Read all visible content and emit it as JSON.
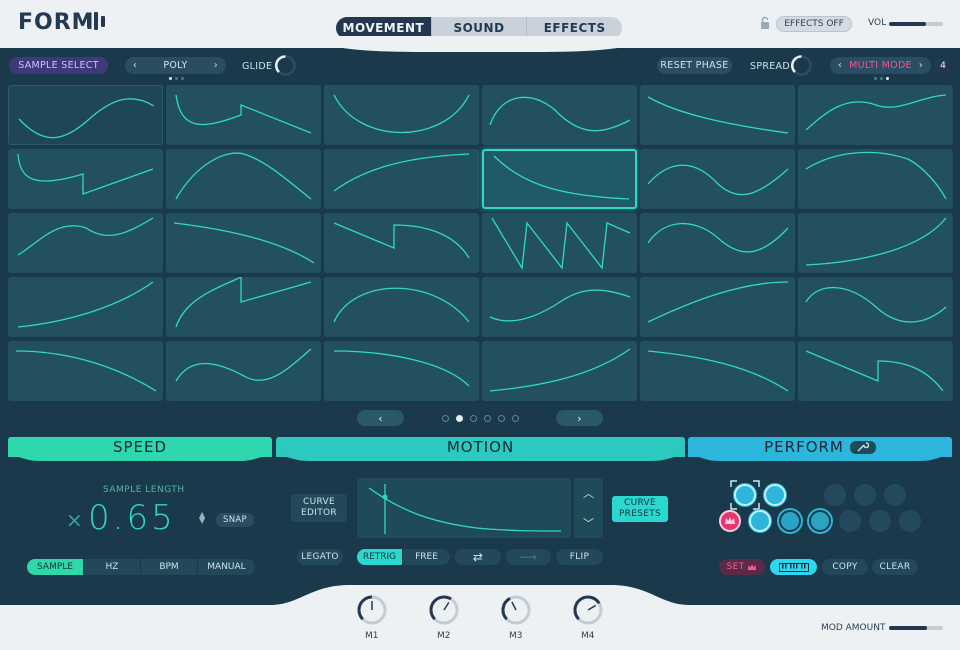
{
  "app": {
    "logo": "FORM",
    "tabs": [
      {
        "label": "MOVEMENT",
        "active": true
      },
      {
        "label": "SOUND",
        "active": false
      },
      {
        "label": "EFFECTS",
        "active": false
      }
    ],
    "effects_toggle": "EFFECTS OFF",
    "vol_label": "VOL",
    "vol_level": 0.68
  },
  "toolbar": {
    "sample_select": "SAMPLE SELECT",
    "voice_mode": "POLY",
    "glide_label": "GLIDE",
    "reset_phase": "RESET PHASE",
    "spread_label": "SPREAD",
    "multi_mode": "MULTI MODE",
    "multi_mode_count": "4",
    "prev_glyph": "‹",
    "next_glyph": "›"
  },
  "grid": {
    "selected_index": 9,
    "pages": 6,
    "current_page": 1
  },
  "speed": {
    "title": "SPEED",
    "sample_length_label": "SAMPLE LENGTH",
    "multiplier_glyph": "×",
    "value": "0.65",
    "snap": "SNAP",
    "modes": [
      "SAMPLE",
      "HZ",
      "BPM",
      "MANUAL"
    ],
    "active_mode": 0
  },
  "motion": {
    "title": "MOTION",
    "curve_editor_1": "CURVE",
    "curve_editor_2": "EDITOR",
    "curve_presets_1": "CURVE",
    "curve_presets_2": "PRESETS",
    "legato": "LEGATO",
    "retrig": "RETRIG",
    "free": "FREE",
    "flip": "FLIP",
    "loop_glyph": "⇄",
    "arrow_glyph": "⟶"
  },
  "perform": {
    "title": "PERFORM",
    "set": "SET",
    "copy": "COPY",
    "clear": "CLEAR"
  },
  "macros": {
    "labels": [
      "M1",
      "M2",
      "M3",
      "M4"
    ],
    "levels": [
      0.5,
      0.62,
      0.4,
      0.72
    ],
    "mod_amount_label": "MOD AMOUNT",
    "mod_amount": 0.7
  },
  "colors": {
    "speed": "#2fd8ac",
    "motion": "#2bc9c0",
    "perform": "#2cb6dc",
    "accent_pink": "#ff4f8a",
    "curve": "#2fd8c8"
  }
}
